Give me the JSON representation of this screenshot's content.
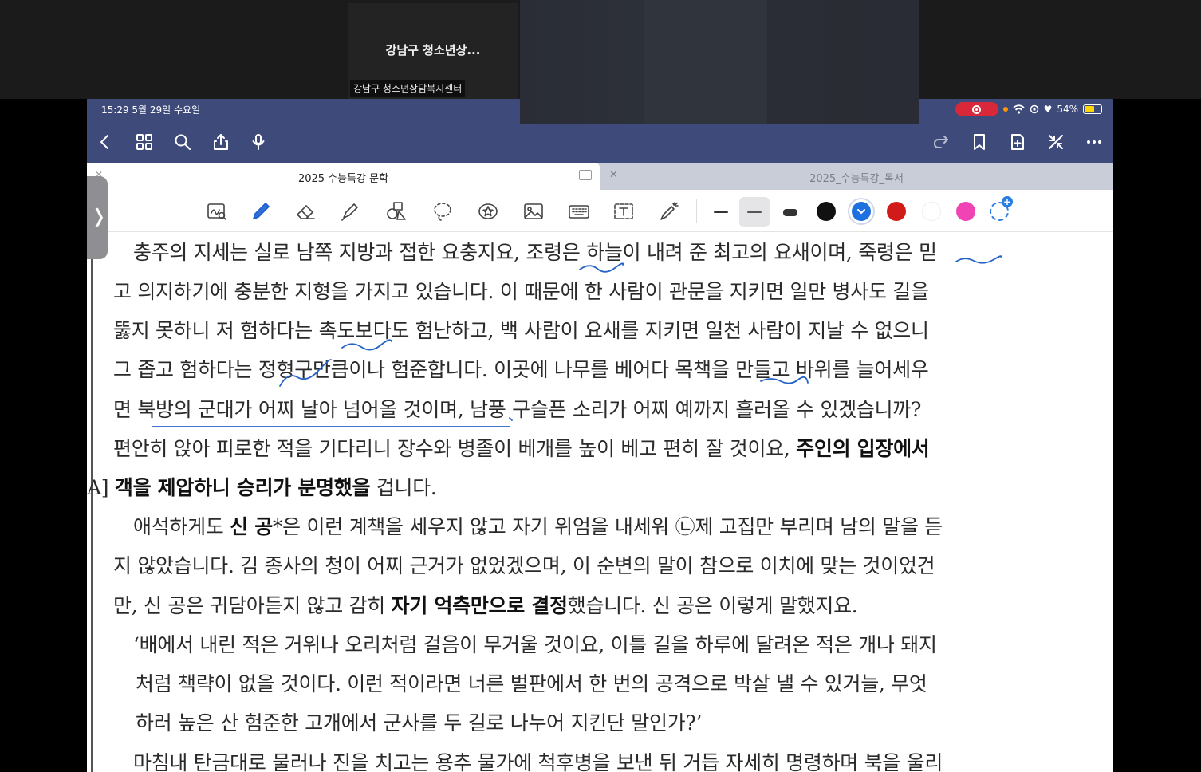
{
  "zoom": {
    "tile_title": "강남구 청소년상...",
    "tile_name": "강남구 청소년상담복지센터"
  },
  "status_bar": {
    "time": "15:29  5월 29일 수요일",
    "battery": "54%"
  },
  "tabs": [
    {
      "label": "2025 수능특강 문학",
      "active": true
    },
    {
      "label": "2025_수능특강_독서",
      "active": false
    }
  ],
  "toolbar": {
    "tools": [
      "zoom-window",
      "pen",
      "eraser",
      "highlighter",
      "shapes",
      "lasso",
      "sticker",
      "image",
      "keyboard",
      "text",
      "laser-pointer"
    ],
    "colors": [
      "#111111",
      "#1e6fe0",
      "#d11a1a",
      "#ffffff",
      "#f043b4"
    ],
    "selected_color": "#1e6fe0"
  },
  "document": {
    "lines": [
      [
        "충주의 지세는 실로 남쪽 지방과 접한 요충지요, 조령은 하늘이 내려 준 최고의 요새이며, 죽령은 믿"
      ],
      [
        "고 의지하기에 충분한 지형을 가지고 있습니다. 이 때문에 한 사람이 관문을 지키면 일만 병사도 길을"
      ],
      [
        "뚫지 못하니 저 험하다는 촉도보다도 험난하고, 백 사람이 요새를 지키면 일천 사람이 지날 수 없으니"
      ],
      [
        "그 좁고 험하다는 정형구만큼이나 험준합니다. 이곳에 나무를 베어다 목책을 만들고 바위를 늘어세우"
      ],
      [
        "면 북방의 군대가 어찌 날아 넘어올 것이며, 남풍 구슬픈 소리가 어찌 예까지 흘러올 수 있겠습니까?"
      ],
      [
        "편안히 앉아 피로한 적을 기다리니 장수와 병졸이 베개를 높이 베고 편히 잘 것이요, ",
        "주인의 입장에서"
      ],
      [
        "객을 제압하니 승리가 분명했을",
        " 겁니다."
      ],
      [
        "애석하게도 ",
        "신 공",
        "*은 이런 계책을 세우지 않고 자기 위엄을 내세워 ",
        "㉡제 고집만 부리며 남의 말을 듣"
      ],
      [
        "지 않았습니다.",
        " 김 종사의 청이 어찌 근거가 없었겠으며, 이 순변의 말이 참으로 이치에 맞는 것이었건"
      ],
      [
        "만, 신 공은 귀담아듣지 않고 감히 ",
        "자기 억측만으로 결정",
        "했습니다. 신 공은 이렇게 말했지요."
      ],
      [
        "‘배에서 내린 적은 거위나 오리처럼 걸음이 무거울 것이요, 이틀 길을 하루에 달려온 적은 개나 돼지"
      ],
      [
        "처럼 책략이 없을 것이다. 이런 적이라면 너른 벌판에서 한 번의 공격으로 박살 낼 수 있거늘, 무엇"
      ],
      [
        "하러 높은 산 험준한 고개에서 군사를 두 길로 나누어 지킨단 말인가?’"
      ],
      [
        "마침내 탄금대로 물러나 진을 치고는 용추 물가에 척후병을 보낸 뒤 거듭 자세히 명령하며 북을 울리"
      ]
    ],
    "margin_label": "A]"
  }
}
